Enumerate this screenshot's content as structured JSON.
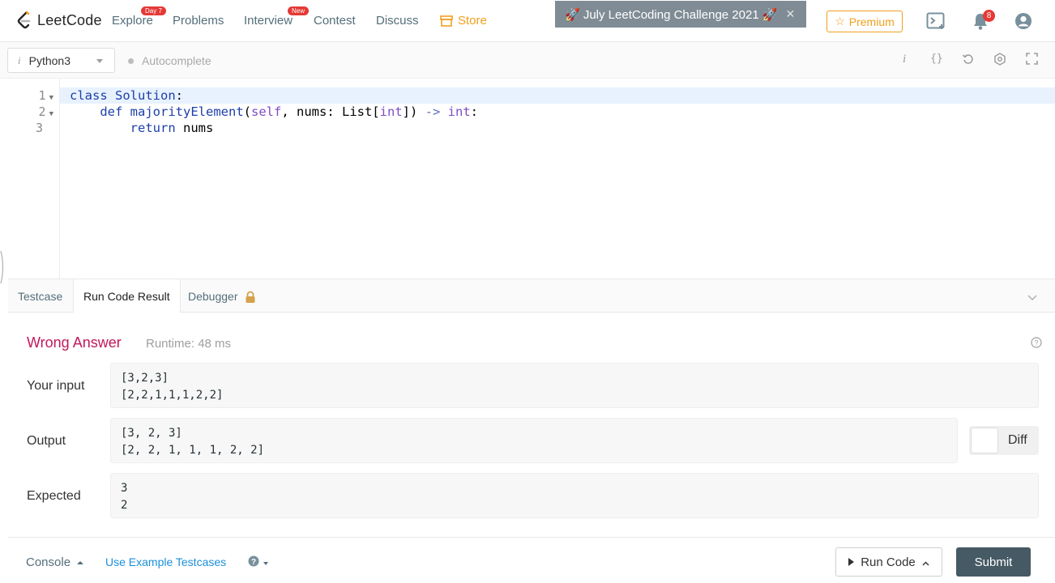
{
  "nav": {
    "logo_text": "LeetCode",
    "items": [
      {
        "label": "Explore",
        "badge": "Day 7"
      },
      {
        "label": "Problems"
      },
      {
        "label": "Interview",
        "badge": "New"
      },
      {
        "label": "Contest"
      },
      {
        "label": "Discuss"
      },
      {
        "label": "Store"
      }
    ],
    "promo": "🚀 July LeetCoding Challenge 2021 🚀",
    "premium_label": "Premium",
    "notification_count": "8"
  },
  "toolbar": {
    "language": "Python3",
    "autocomplete_label": "Autocomplete",
    "icons": [
      "info-icon",
      "format-braces-icon",
      "reset-icon",
      "settings-icon",
      "fullscreen-icon"
    ]
  },
  "editor": {
    "line_numbers": [
      "1",
      "2",
      "3"
    ],
    "code": [
      "class Solution:",
      "    def majorityElement(self, nums: List[int]) -> int:",
      "        return nums"
    ]
  },
  "tabs": {
    "items": [
      "Testcase",
      "Run Code Result",
      "Debugger"
    ],
    "active": "Run Code Result"
  },
  "result": {
    "verdict": "Wrong Answer",
    "runtime": "Runtime: 48 ms",
    "input_label": "Your input",
    "input_value": "[3,2,3]\n[2,2,1,1,1,2,2]",
    "output_label": "Output",
    "output_value": "[3, 2, 3]\n[2, 2, 1, 1, 1, 2, 2]",
    "expected_label": "Expected",
    "expected_value": "3\n2",
    "diff_label": "Diff"
  },
  "footer": {
    "console_label": "Console",
    "use_example_label": "Use Example Testcases",
    "run_code_label": "Run Code",
    "submit_label": "Submit"
  },
  "colors": {
    "wrong_answer": "#c2185b",
    "store": "#f0a020",
    "submit_bg": "#455a64",
    "link": "#1a90d9"
  }
}
